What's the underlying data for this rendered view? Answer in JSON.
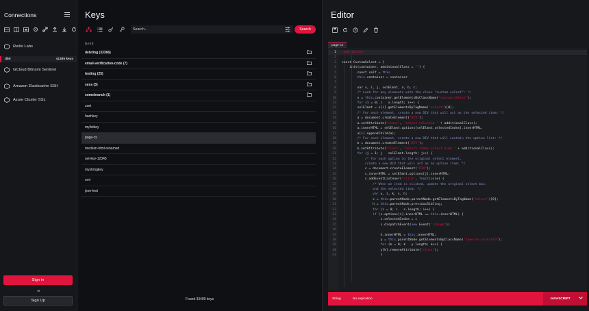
{
  "sidebar": {
    "title": "Connections",
    "toolbar_icons": [
      "add-connection-icon",
      "add-cluster-icon",
      "add-sentinel-icon",
      "settings-icon",
      "link-icon",
      "export-icon",
      "import-icon",
      "refresh-icon"
    ],
    "connections": [
      {
        "name": "Redis Labs",
        "icon": "server-icon"
      },
      {
        "name": "GCloud Bitnami Sentinel",
        "icon": "server-icon"
      },
      {
        "name": "Amazon Elasticache SSH",
        "icon": "server-icon"
      },
      {
        "name": "Azure Cluster SSL",
        "icon": "server-icon"
      }
    ],
    "db": {
      "name": "db0",
      "keys": "41385 keys"
    },
    "sign_in": "Sign in",
    "or": "or",
    "sign_up": "Sign Up"
  },
  "keys": {
    "title": "Keys",
    "toolbar_icons": [
      "tree-view-icon",
      "list-view-icon",
      "key-add-icon",
      "key-icon"
    ],
    "search_placeholder": "Search...",
    "search_button": "Search",
    "base_label": "BASE",
    "items": [
      {
        "name": "deleting (33366)",
        "folder": true
      },
      {
        "name": "email-verification-code (7)",
        "folder": true
      },
      {
        "name": "testing (25)",
        "folder": true
      },
      {
        "name": "sess (3)",
        "folder": true
      },
      {
        "name": "somebranch (1)",
        "folder": true
      },
      {
        "name": "zset",
        "folder": false
      },
      {
        "name": "hashkey",
        "folder": false
      },
      {
        "name": "mylistkey",
        "folder": false
      },
      {
        "name": "page-cs",
        "folder": false,
        "selected": true
      },
      {
        "name": "medium-html-renamed",
        "folder": false
      },
      {
        "name": "set-key-12345",
        "folder": false
      },
      {
        "name": "mystringkey",
        "folder": false
      },
      {
        "name": "xml",
        "folder": false
      },
      {
        "name": "json-test",
        "folder": false
      }
    ],
    "found": "Found 33409 keys"
  },
  "editor": {
    "title": "Editor",
    "toolbar_icons": [
      "save-icon",
      "refresh-icon",
      "ttl-clock-icon",
      "edit-icon",
      "delete-icon"
    ],
    "tab": "page-cs",
    "type": "String",
    "ttl": "No expiration",
    "language": "JAVASCRIPT",
    "lines": [
      [
        [
          "s",
          "'use strict'"
        ]
      ],
      [],
      [
        [
          "t",
          "const CustomSelect = {"
        ]
      ],
      [
        [
          "t",
          "    init(container, additionalClass = '') {"
        ]
      ],
      [
        [
          "t",
          "        const self = "
        ],
        [
          "k",
          "this"
        ]
      ],
      [
        [
          "t",
          "        "
        ],
        [
          "k",
          "this"
        ],
        [
          "t",
          ".container = container"
        ]
      ],
      [],
      [
        [
          "t",
          "        var x, i, j, selElmnt, a, b, c;"
        ]
      ],
      [
        [
          "c",
          "        /* Look for any elements with the class \"custom-select\": */"
        ]
      ],
      [
        [
          "t",
          "        x = "
        ],
        [
          "k",
          "this"
        ],
        [
          "t",
          ".container.getElementsByClassName("
        ],
        [
          "s",
          "\"custom-select\""
        ],
        [
          "t",
          ");"
        ]
      ],
      [
        [
          "k",
          "        for"
        ],
        [
          "t",
          " (i = 0; i   x.length; i++) {"
        ]
      ],
      [
        [
          "t",
          "        selElmnt = x[i].getElementsByTagName("
        ],
        [
          "s",
          "\"select\""
        ],
        [
          "t",
          ")[0];"
        ]
      ],
      [
        [
          "c",
          "        /* For each element, create a new DIV that will act as the selected item: */"
        ]
      ],
      [
        [
          "t",
          "        a = document.createElement("
        ],
        [
          "s",
          "\"DIV\""
        ],
        [
          "t",
          ");"
        ]
      ],
      [
        [
          "t",
          "        a.setAttribute("
        ],
        [
          "s",
          "\"class\""
        ],
        [
          "t",
          ", "
        ],
        [
          "s",
          "\"select-selected \""
        ],
        [
          "t",
          " + additionalClass);"
        ]
      ],
      [
        [
          "t",
          "        a.innerHTML = selElmnt.options[selElmnt.selectedIndex].innerHTML;"
        ]
      ],
      [
        [
          "t",
          "        x[i].appendChild(a);"
        ]
      ],
      [
        [
          "c",
          "        /* For each element, create a new DIV that will contain the option list: */"
        ]
      ],
      [
        [
          "t",
          "        b = document.createElement("
        ],
        [
          "s",
          "\"DIV\""
        ],
        [
          "t",
          ");"
        ]
      ],
      [
        [
          "t",
          "        b.setAttribute("
        ],
        [
          "s",
          "\"class\""
        ],
        [
          "t",
          ", "
        ],
        [
          "s",
          "\"select-items select-hide \""
        ],
        [
          "t",
          " + additionalClass);"
        ]
      ],
      [
        [
          "k",
          "        for"
        ],
        [
          "t",
          " (j = 1; j   selElmnt.length; j++) {"
        ]
      ],
      [
        [
          "c",
          "            /* For each option in the original select element,"
        ]
      ],
      [
        [
          "c",
          "            create a new DIV that will act as an option item: */"
        ]
      ],
      [
        [
          "t",
          "            c = document.createElement("
        ],
        [
          "s",
          "\"DIV\""
        ],
        [
          "t",
          ");"
        ]
      ],
      [
        [
          "t",
          "            c.innerHTML = selElmnt.options[j].innerHTML;"
        ]
      ],
      [
        [
          "t",
          "            c.addEventListener("
        ],
        [
          "s",
          "\"click\""
        ],
        [
          "t",
          ", "
        ],
        [
          "k",
          "function"
        ],
        [
          "t",
          "(e) {"
        ]
      ],
      [
        [
          "c",
          "                /* When an item is clicked, update the original select box,"
        ]
      ],
      [
        [
          "c",
          "                and the selected item: */"
        ]
      ],
      [
        [
          "k",
          "                var"
        ],
        [
          "t",
          " y, i, k, s, h;"
        ]
      ],
      [
        [
          "t",
          "                s = "
        ],
        [
          "k",
          "this"
        ],
        [
          "t",
          ".parentNode.parentNode.getElementsByTagName("
        ],
        [
          "s",
          "\"select\""
        ],
        [
          "t",
          ")[0];"
        ]
      ],
      [
        [
          "t",
          "                h = "
        ],
        [
          "k",
          "this"
        ],
        [
          "t",
          ".parentNode.previousSibling;"
        ]
      ],
      [
        [
          "k",
          "                for"
        ],
        [
          "t",
          " (i = 0; i   s.length; i++) {"
        ]
      ],
      [
        [
          "k",
          "                if"
        ],
        [
          "t",
          " (s.options[i].innerHTML == "
        ],
        [
          "k",
          "this"
        ],
        [
          "t",
          ".innerHTML) {"
        ]
      ],
      [
        [
          "t",
          "                    s.selectedIndex = i"
        ]
      ],
      [
        [
          "t",
          "                    s.dispatchEvent("
        ],
        [
          "k",
          "new"
        ],
        [
          "t",
          " Event("
        ],
        [
          "s",
          "\"change\""
        ],
        [
          "t",
          "))"
        ]
      ],
      [],
      [
        [
          "t",
          "                    h.innerHTML = "
        ],
        [
          "k",
          "this"
        ],
        [
          "t",
          ".innerHTML;"
        ]
      ],
      [
        [
          "t",
          "                    y = "
        ],
        [
          "k",
          "this"
        ],
        [
          "t",
          ".parentNode.getElementsByClassName("
        ],
        [
          "s",
          "\"same-as-selected\""
        ],
        [
          "t",
          ");"
        ]
      ],
      [
        [
          "k",
          "                    for"
        ],
        [
          "t",
          " (k = 0; k   y.length; k++) {"
        ]
      ],
      [
        [
          "t",
          "                    y[k].removeAttribute("
        ],
        [
          "s",
          "\"class\""
        ],
        [
          "t",
          ");"
        ]
      ],
      [
        [
          "t",
          "                    }"
        ]
      ]
    ]
  }
}
